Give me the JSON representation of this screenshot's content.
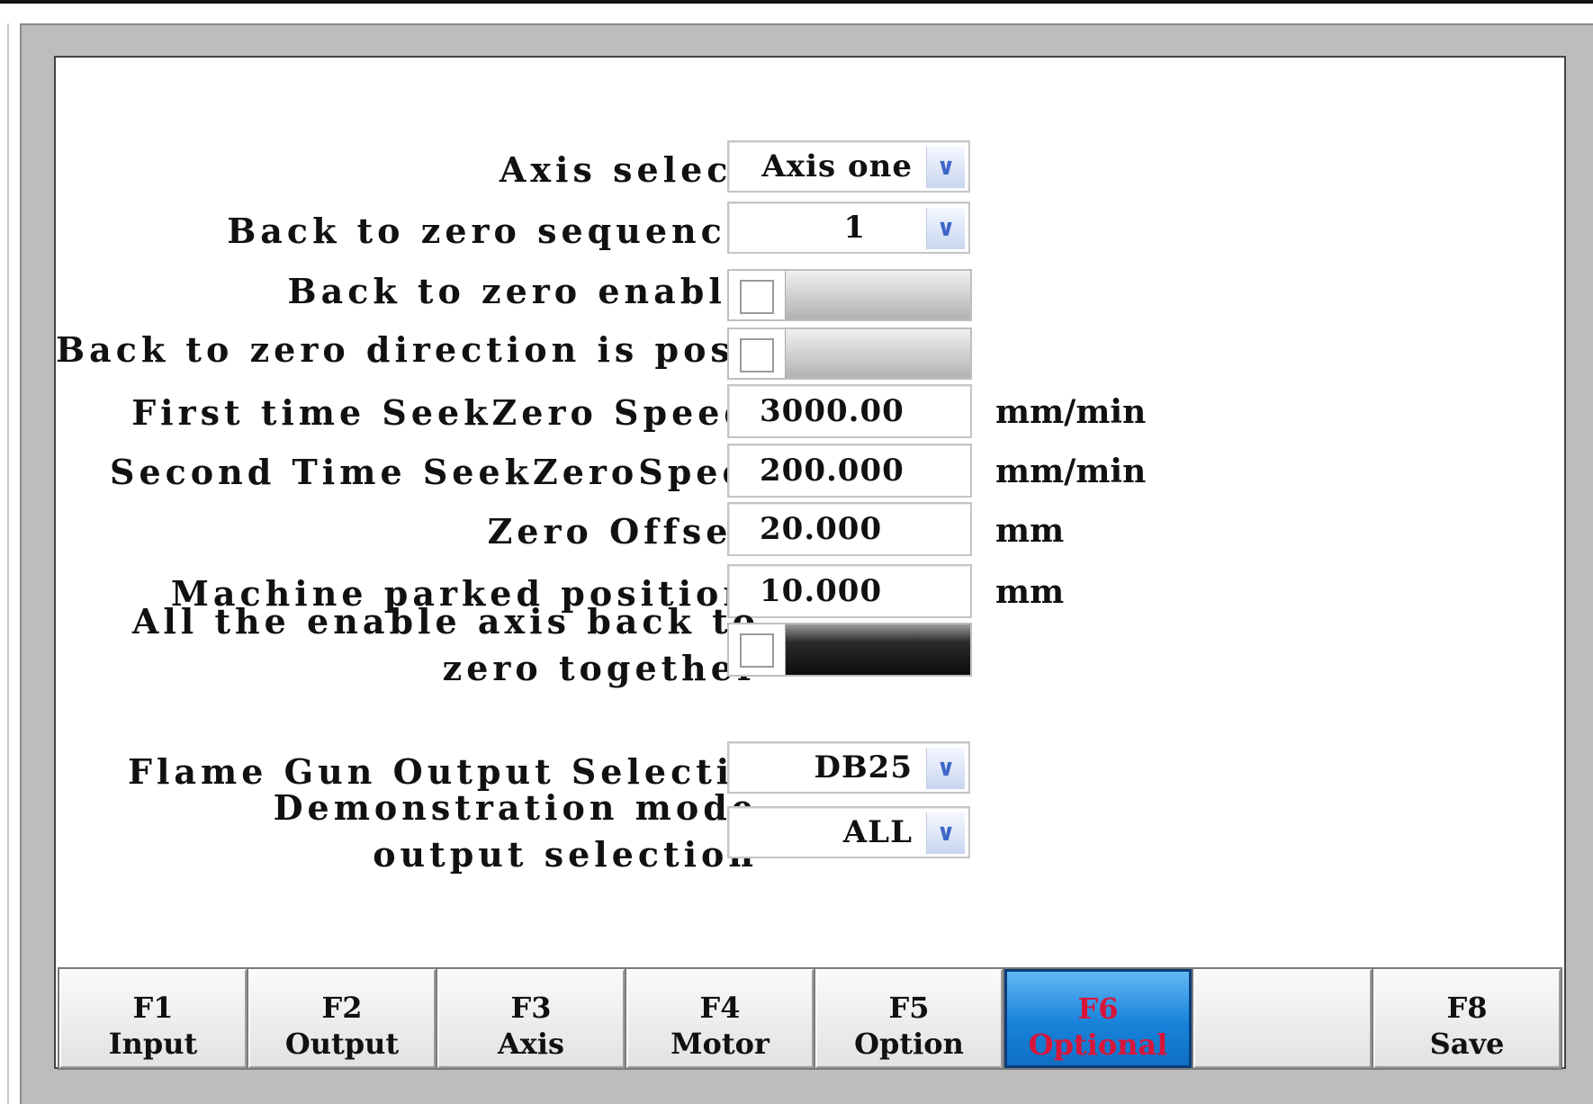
{
  "fields": {
    "axis_select": {
      "label": "Axis select",
      "value": "Axis one"
    },
    "back_to_zero_sequence": {
      "label": "Back to zero sequence",
      "value": "1"
    },
    "back_to_zero_enable": {
      "label": "Back to zero enable",
      "checked": false
    },
    "back_to_zero_direction": {
      "label": "Back to zero direction is positi",
      "checked": false
    },
    "first_seek_speed": {
      "label": "First time SeekZero Speed",
      "value": "3000.00",
      "unit": "mm/min"
    },
    "second_seek_speed": {
      "label": "Second Time SeekZeroSpeed",
      "value": "200.000",
      "unit": "mm/min"
    },
    "zero_offset": {
      "label": "Zero Offset",
      "value": "20.000",
      "unit": "mm"
    },
    "parked_position": {
      "label": "Machine parked position",
      "value": "10.000",
      "unit": "mm"
    },
    "all_axis_together": {
      "label": "All the enable axis back to zero together",
      "checked": false
    },
    "flame_gun_output": {
      "label": "Flame Gun Output Selection",
      "value": "DB25"
    },
    "demo_mode_output": {
      "label": "Demonstration mode output selection",
      "value": "ALL"
    }
  },
  "function_keys": [
    {
      "key": "F1",
      "label": "Input"
    },
    {
      "key": "F2",
      "label": "Output"
    },
    {
      "key": "F3",
      "label": "Axis"
    },
    {
      "key": "F4",
      "label": "Motor"
    },
    {
      "key": "F5",
      "label": "Option"
    },
    {
      "key": "F6",
      "label": "Optional",
      "active": true
    },
    {
      "key": "",
      "label": ""
    },
    {
      "key": "F8",
      "label": "Save"
    }
  ],
  "icons": {
    "dropdown_arrow": "chevron-down-icon"
  },
  "colors": {
    "active_key_bg": "#1883db",
    "active_key_text": "#d8163a",
    "dropdown_arrow": "#3f67c8"
  }
}
